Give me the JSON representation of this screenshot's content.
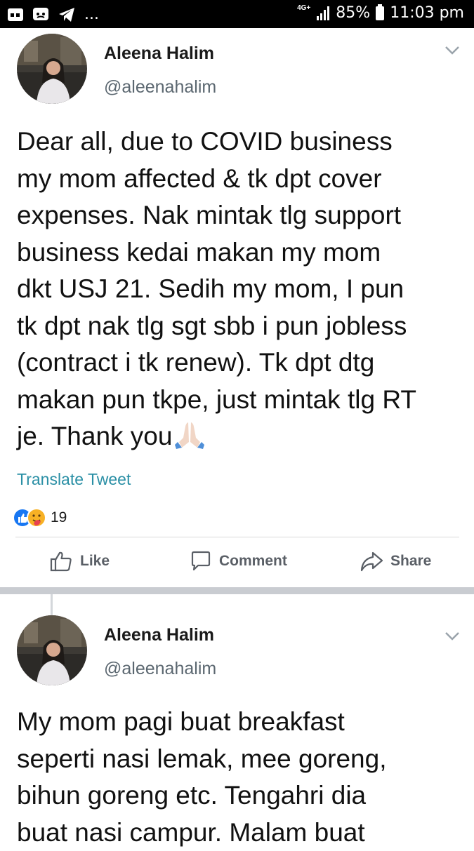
{
  "status_bar": {
    "network": "4G+",
    "battery": "85%",
    "time": "11:03 pm",
    "more": "..."
  },
  "posts": [
    {
      "author_name": "Aleena Halim",
      "handle": "@aleenahalim",
      "lines": [
        "Dear all, due to COVID business",
        "my mom affected & tk dpt cover",
        "expenses. Nak mintak tlg support",
        "business kedai makan my mom",
        "dkt USJ 21. Sedih my mom, I pun",
        "tk dpt nak tlg sgt sbb i pun jobless",
        "(contract i tk renew). Tk dpt dtg",
        "makan pun tkpe, just mintak tlg RT",
        "je. Thank you"
      ],
      "translate_label": "Translate Tweet"
    },
    {
      "author_name": "Aleena Halim",
      "handle": "@aleenahalim",
      "lines": [
        "My mom pagi buat breakfast",
        "seperti nasi lemak, mee goreng,",
        "bihun goreng etc. Tengahri dia",
        "buat nasi campur. Malam buat"
      ]
    }
  ],
  "reactions": {
    "count": "19"
  },
  "actions": {
    "like": "Like",
    "comment": "Comment",
    "share": "Share"
  },
  "colors": {
    "link": "#2a8fa5",
    "like_blue": "#1877f2",
    "separator": "#c9ccd1"
  }
}
